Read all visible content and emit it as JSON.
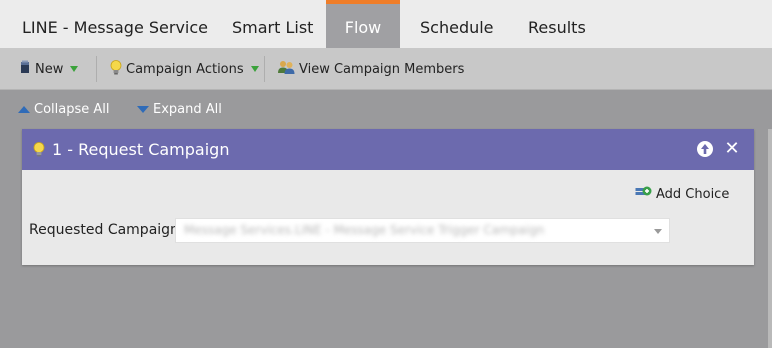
{
  "tabs": [
    {
      "label": "LINE - Message Service",
      "active": false
    },
    {
      "label": "Smart List",
      "active": false
    },
    {
      "label": "Flow",
      "active": true
    },
    {
      "label": "Schedule",
      "active": false
    },
    {
      "label": "Results",
      "active": false
    }
  ],
  "toolbar": {
    "new_label": "New",
    "campaign_actions_label": "Campaign Actions",
    "view_members_label": "View Campaign Members"
  },
  "flow_controls": {
    "collapse_label": "Collapse All",
    "expand_label": "Expand All"
  },
  "flow_step": {
    "title": "1 - Request Campaign",
    "add_choice_label": "Add Choice",
    "field_label": "Requested Campaign:",
    "field_value": "Message Services.LINE - Message Service Trigger Campaign"
  },
  "colors": {
    "active_tab_accent": "#ef7d28",
    "step_header": "#6c6aae",
    "link_blue": "#2f6bb8",
    "dropdown_green": "#3ba23b"
  },
  "icons": {
    "new": "new-document-icon",
    "campaign_actions": "lightbulb-icon",
    "view_members": "people-icon",
    "collapse": "triangle-up-icon",
    "expand": "triangle-down-icon",
    "step": "lightbulb-icon",
    "move_up": "arrow-up-circle-icon",
    "close": "close-icon",
    "add_choice": "add-choice-icon"
  }
}
